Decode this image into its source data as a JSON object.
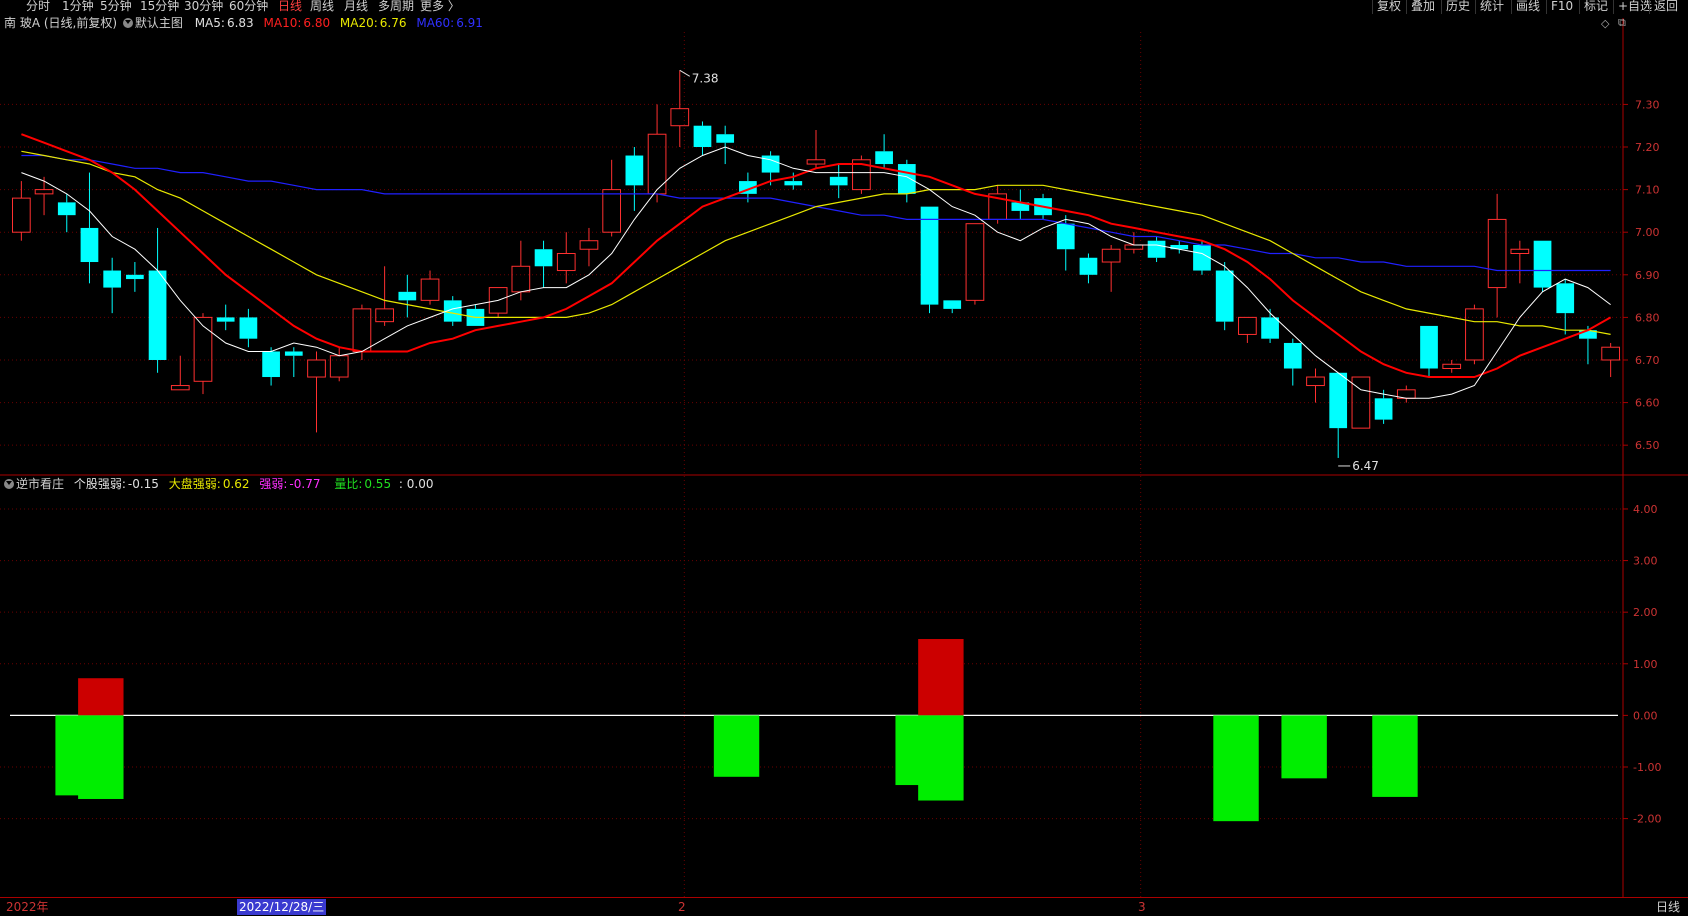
{
  "toolbar": {
    "left": [
      "分时",
      "1分钟",
      "5分钟",
      "15分钟",
      "30分钟",
      "60分钟",
      "日线",
      "周线",
      "月线",
      "多周期",
      "更多 〉"
    ],
    "active_index": 6,
    "right": [
      "复权",
      "叠加",
      "历史",
      "统计",
      "画线",
      "F10",
      "标记",
      "+自选",
      "返回"
    ]
  },
  "main_legend": {
    "stock": "南 玻A (日线,前复权)",
    "template": "默认主图",
    "ma5_label": "MA5:",
    "ma5_value": "6.83",
    "ma10_label": "MA10:",
    "ma10_value": "6.80",
    "ma20_label": "MA20:",
    "ma20_value": "6.76",
    "ma60_label": "MA60:",
    "ma60_value": "6.91"
  },
  "sub_legend": {
    "name": "逆市看庄",
    "stock_strength_label": "个股强弱:",
    "stock_strength_value": "-0.15",
    "market_strength_label": "大盘强弱:",
    "market_strength_value": "0.62",
    "strength_label": "强弱:",
    "strength_value": "-0.77",
    "volume_ratio_label": "量比:",
    "volume_ratio_value": "0.55",
    "extra_value": ": 0.00"
  },
  "colors": {
    "up": "#ff3030",
    "down": "#00ffff",
    "ma5": "#ffffff",
    "ma10": "#ff0000",
    "ma20": "#e8e800",
    "ma60": "#2020ff",
    "pos_bar": "#cc0000",
    "neg_bar": "#00ee00",
    "axis": "#aa0000",
    "grid": "#6a0000"
  },
  "annotations": {
    "high": "7.38",
    "low": "6.47"
  },
  "bottom": {
    "year_label": "2022年",
    "cursor_date": "2022/12/28/三",
    "month_labels": [
      "2",
      "3"
    ],
    "period": "日线"
  },
  "chart_data": [
    {
      "type": "candlestick",
      "title": "南 玻A (日线,前复权)",
      "y_axis_ticks": [
        "7.30",
        "7.20",
        "7.10",
        "7.00",
        "6.90",
        "6.80",
        "6.70",
        "6.60",
        "6.50"
      ],
      "ylim": [
        6.43,
        7.47
      ],
      "candles": [
        {
          "o": 7.0,
          "c": 7.08,
          "h": 7.12,
          "l": 6.98
        },
        {
          "o": 7.09,
          "c": 7.1,
          "h": 7.13,
          "l": 7.04
        },
        {
          "o": 7.07,
          "c": 7.04,
          "h": 7.09,
          "l": 7.0
        },
        {
          "o": 7.01,
          "c": 6.93,
          "h": 7.14,
          "l": 6.88
        },
        {
          "o": 6.91,
          "c": 6.87,
          "h": 6.94,
          "l": 6.81
        },
        {
          "o": 6.9,
          "c": 6.89,
          "h": 6.93,
          "l": 6.86
        },
        {
          "o": 6.91,
          "c": 6.7,
          "h": 7.01,
          "l": 6.67
        },
        {
          "o": 6.63,
          "c": 6.64,
          "h": 6.71,
          "l": 6.63
        },
        {
          "o": 6.65,
          "c": 6.8,
          "h": 6.81,
          "l": 6.62
        },
        {
          "o": 6.8,
          "c": 6.79,
          "h": 6.83,
          "l": 6.77
        },
        {
          "o": 6.8,
          "c": 6.75,
          "h": 6.82,
          "l": 6.73
        },
        {
          "o": 6.72,
          "c": 6.66,
          "h": 6.73,
          "l": 6.64
        },
        {
          "o": 6.72,
          "c": 6.71,
          "h": 6.73,
          "l": 6.66
        },
        {
          "o": 6.66,
          "c": 6.7,
          "h": 6.72,
          "l": 6.53
        },
        {
          "o": 6.66,
          "c": 6.71,
          "h": 6.73,
          "l": 6.65
        },
        {
          "o": 6.72,
          "c": 6.82,
          "h": 6.83,
          "l": 6.7
        },
        {
          "o": 6.79,
          "c": 6.82,
          "h": 6.92,
          "l": 6.78
        },
        {
          "o": 6.86,
          "c": 6.84,
          "h": 6.9,
          "l": 6.8
        },
        {
          "o": 6.84,
          "c": 6.89,
          "h": 6.91,
          "l": 6.83
        },
        {
          "o": 6.84,
          "c": 6.79,
          "h": 6.85,
          "l": 6.78
        },
        {
          "o": 6.82,
          "c": 6.78,
          "h": 6.83,
          "l": 6.78
        },
        {
          "o": 6.81,
          "c": 6.87,
          "h": 6.87,
          "l": 6.8
        },
        {
          "o": 6.86,
          "c": 6.92,
          "h": 6.98,
          "l": 6.84
        },
        {
          "o": 6.96,
          "c": 6.92,
          "h": 6.98,
          "l": 6.87
        },
        {
          "o": 6.91,
          "c": 6.95,
          "h": 7.0,
          "l": 6.88
        },
        {
          "o": 6.96,
          "c": 6.98,
          "h": 7.01,
          "l": 6.92
        },
        {
          "o": 7.0,
          "c": 7.1,
          "h": 7.17,
          "l": 6.99
        },
        {
          "o": 7.18,
          "c": 7.11,
          "h": 7.2,
          "l": 7.05
        },
        {
          "o": 7.09,
          "c": 7.23,
          "h": 7.3,
          "l": 7.07
        },
        {
          "o": 7.25,
          "c": 7.29,
          "h": 7.38,
          "l": 7.2
        },
        {
          "o": 7.25,
          "c": 7.2,
          "h": 7.26,
          "l": 7.18
        },
        {
          "o": 7.23,
          "c": 7.21,
          "h": 7.25,
          "l": 7.16
        },
        {
          "o": 7.12,
          "c": 7.09,
          "h": 7.14,
          "l": 7.07
        },
        {
          "o": 7.18,
          "c": 7.14,
          "h": 7.19,
          "l": 7.11
        },
        {
          "o": 7.12,
          "c": 7.11,
          "h": 7.14,
          "l": 7.1
        },
        {
          "o": 7.16,
          "c": 7.17,
          "h": 7.24,
          "l": 7.15
        },
        {
          "o": 7.13,
          "c": 7.11,
          "h": 7.16,
          "l": 7.08
        },
        {
          "o": 7.1,
          "c": 7.17,
          "h": 7.18,
          "l": 7.09
        },
        {
          "o": 7.19,
          "c": 7.16,
          "h": 7.23,
          "l": 7.15
        },
        {
          "o": 7.16,
          "c": 7.09,
          "h": 7.17,
          "l": 7.07
        },
        {
          "o": 7.06,
          "c": 6.83,
          "h": 7.06,
          "l": 6.81
        },
        {
          "o": 6.84,
          "c": 6.82,
          "h": 6.84,
          "l": 6.81
        },
        {
          "o": 6.84,
          "c": 7.02,
          "h": 7.02,
          "l": 6.83
        },
        {
          "o": 7.03,
          "c": 7.09,
          "h": 7.11,
          "l": 7.02
        },
        {
          "o": 7.07,
          "c": 7.05,
          "h": 7.1,
          "l": 7.03
        },
        {
          "o": 7.08,
          "c": 7.04,
          "h": 7.09,
          "l": 7.03
        },
        {
          "o": 7.02,
          "c": 6.96,
          "h": 7.04,
          "l": 6.91
        },
        {
          "o": 6.94,
          "c": 6.9,
          "h": 6.95,
          "l": 6.88
        },
        {
          "o": 6.93,
          "c": 6.96,
          "h": 6.97,
          "l": 6.86
        },
        {
          "o": 6.96,
          "c": 6.97,
          "h": 7.0,
          "l": 6.95
        },
        {
          "o": 6.98,
          "c": 6.94,
          "h": 6.99,
          "l": 6.93
        },
        {
          "o": 6.97,
          "c": 6.96,
          "h": 6.98,
          "l": 6.95
        },
        {
          "o": 6.97,
          "c": 6.91,
          "h": 6.98,
          "l": 6.9
        },
        {
          "o": 6.91,
          "c": 6.79,
          "h": 6.93,
          "l": 6.77
        },
        {
          "o": 6.76,
          "c": 6.8,
          "h": 6.8,
          "l": 6.74
        },
        {
          "o": 6.8,
          "c": 6.75,
          "h": 6.82,
          "l": 6.74
        },
        {
          "o": 6.74,
          "c": 6.68,
          "h": 6.75,
          "l": 6.64
        },
        {
          "o": 6.64,
          "c": 6.66,
          "h": 6.68,
          "l": 6.6
        },
        {
          "o": 6.67,
          "c": 6.54,
          "h": 6.67,
          "l": 6.47
        },
        {
          "o": 6.54,
          "c": 6.66,
          "h": 6.66,
          "l": 6.54
        },
        {
          "o": 6.61,
          "c": 6.56,
          "h": 6.63,
          "l": 6.55
        },
        {
          "o": 6.61,
          "c": 6.63,
          "h": 6.64,
          "l": 6.6
        },
        {
          "o": 6.78,
          "c": 6.68,
          "h": 6.78,
          "l": 6.66
        },
        {
          "o": 6.68,
          "c": 6.69,
          "h": 6.7,
          "l": 6.67
        },
        {
          "o": 6.7,
          "c": 6.82,
          "h": 6.83,
          "l": 6.69
        },
        {
          "o": 6.87,
          "c": 7.03,
          "h": 7.09,
          "l": 6.8
        },
        {
          "o": 6.95,
          "c": 6.96,
          "h": 6.98,
          "l": 6.88
        },
        {
          "o": 6.98,
          "c": 6.87,
          "h": 6.98,
          "l": 6.86
        },
        {
          "o": 6.88,
          "c": 6.81,
          "h": 6.89,
          "l": 6.76
        },
        {
          "o": 6.77,
          "c": 6.75,
          "h": 6.78,
          "l": 6.69
        },
        {
          "o": 6.7,
          "c": 6.73,
          "h": 6.74,
          "l": 6.66
        }
      ],
      "ma5": [
        7.14,
        7.12,
        7.09,
        7.05,
        6.99,
        6.96,
        6.91,
        6.84,
        6.78,
        6.74,
        6.72,
        6.72,
        6.74,
        6.73,
        6.71,
        6.72,
        6.75,
        6.78,
        6.8,
        6.82,
        6.83,
        6.84,
        6.86,
        6.87,
        6.87,
        6.9,
        6.95,
        7.03,
        7.1,
        7.15,
        7.18,
        7.2,
        7.18,
        7.17,
        7.15,
        7.14,
        7.14,
        7.14,
        7.14,
        7.13,
        7.1,
        7.06,
        7.04,
        7.0,
        6.98,
        7.01,
        7.03,
        7.02,
        6.99,
        6.97,
        6.97,
        6.96,
        6.95,
        6.92,
        6.87,
        6.81,
        6.76,
        6.71,
        6.67,
        6.63,
        6.62,
        6.61,
        6.61,
        6.62,
        6.64,
        6.72,
        6.8,
        6.86,
        6.89,
        6.87,
        6.83
      ],
      "ma10": [
        7.23,
        7.21,
        7.19,
        7.17,
        7.14,
        7.1,
        7.05,
        7.0,
        6.95,
        6.9,
        6.86,
        6.82,
        6.78,
        6.75,
        6.73,
        6.72,
        6.72,
        6.72,
        6.74,
        6.75,
        6.77,
        6.78,
        6.79,
        6.8,
        6.82,
        6.85,
        6.88,
        6.93,
        6.98,
        7.02,
        7.06,
        7.08,
        7.1,
        7.12,
        7.13,
        7.15,
        7.16,
        7.16,
        7.15,
        7.14,
        7.13,
        7.11,
        7.09,
        7.08,
        7.07,
        7.06,
        7.05,
        7.04,
        7.02,
        7.01,
        7.0,
        6.99,
        6.98,
        6.96,
        6.93,
        6.89,
        6.84,
        6.8,
        6.76,
        6.72,
        6.69,
        6.67,
        6.66,
        6.66,
        6.66,
        6.68,
        6.71,
        6.73,
        6.75,
        6.77,
        6.8
      ],
      "ma20": [
        7.19,
        7.18,
        7.17,
        7.16,
        7.14,
        7.13,
        7.1,
        7.08,
        7.05,
        7.02,
        6.99,
        6.96,
        6.93,
        6.9,
        6.88,
        6.86,
        6.84,
        6.83,
        6.82,
        6.81,
        6.8,
        6.8,
        6.8,
        6.8,
        6.8,
        6.81,
        6.83,
        6.86,
        6.89,
        6.92,
        6.95,
        6.98,
        7.0,
        7.02,
        7.04,
        7.06,
        7.07,
        7.08,
        7.09,
        7.09,
        7.1,
        7.1,
        7.1,
        7.11,
        7.11,
        7.11,
        7.1,
        7.09,
        7.08,
        7.07,
        7.06,
        7.05,
        7.04,
        7.02,
        7.0,
        6.98,
        6.95,
        6.92,
        6.89,
        6.86,
        6.84,
        6.82,
        6.81,
        6.8,
        6.79,
        6.79,
        6.78,
        6.78,
        6.77,
        6.77,
        6.76
      ],
      "ma60": [
        7.18,
        7.18,
        7.17,
        7.17,
        7.16,
        7.15,
        7.15,
        7.14,
        7.14,
        7.13,
        7.12,
        7.12,
        7.11,
        7.1,
        7.1,
        7.1,
        7.09,
        7.09,
        7.09,
        7.09,
        7.09,
        7.09,
        7.09,
        7.09,
        7.09,
        7.09,
        7.09,
        7.09,
        7.09,
        7.08,
        7.08,
        7.08,
        7.08,
        7.08,
        7.07,
        7.06,
        7.05,
        7.04,
        7.04,
        7.03,
        7.03,
        7.03,
        7.03,
        7.03,
        7.03,
        7.03,
        7.02,
        7.01,
        7.0,
        6.99,
        6.99,
        6.98,
        6.97,
        6.97,
        6.96,
        6.95,
        6.95,
        6.94,
        6.94,
        6.93,
        6.93,
        6.92,
        6.92,
        6.92,
        6.92,
        6.91,
        6.91,
        6.91,
        6.91,
        6.91,
        6.91
      ]
    },
    {
      "type": "bar",
      "title": "逆市看庄",
      "y_axis_ticks": [
        "4.00",
        "3.00",
        "2.00",
        "1.00",
        "0.00",
        "-1.00",
        "-2.00"
      ],
      "ylim": [
        -3.5,
        4.6
      ],
      "bars": [
        {
          "i": 2.5,
          "value": -1.55,
          "color": "neg"
        },
        {
          "i": 3.5,
          "value": 0.72,
          "color": "pos"
        },
        {
          "i": 3.5,
          "value": -1.62,
          "color": "neg"
        },
        {
          "i": 31.5,
          "value": -1.19,
          "color": "neg"
        },
        {
          "i": 39.5,
          "value": -1.35,
          "color": "neg"
        },
        {
          "i": 40.5,
          "value": 1.48,
          "color": "pos"
        },
        {
          "i": 40.5,
          "value": -1.65,
          "color": "neg"
        },
        {
          "i": 53.5,
          "value": -2.05,
          "color": "neg"
        },
        {
          "i": 56.5,
          "value": -1.22,
          "color": "neg"
        },
        {
          "i": 60.5,
          "value": -1.58,
          "color": "neg"
        }
      ]
    }
  ]
}
